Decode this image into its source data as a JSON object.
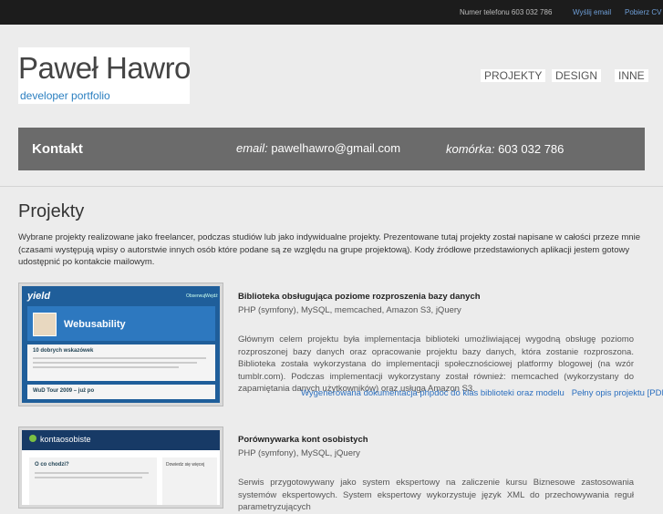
{
  "topbar": {
    "phone_text": "Numer telefonu 603 032 786",
    "send_email": "Wyślij email",
    "download_cv": "Pobierz CV"
  },
  "logo": {
    "name": "Paweł Hawro",
    "subtitle": "developer portfolio"
  },
  "nav": {
    "projekty": "PROJEKTY",
    "design": "DESIGN",
    "inne": "INNE"
  },
  "contact": {
    "title": "Kontakt",
    "email_label": "email:",
    "email_value": "pawelhawro@gmail.com",
    "phone_label": "komórka:",
    "phone_value": "603 032 786"
  },
  "main": {
    "heading": "Projekty",
    "intro": "Wybrane projekty realizowane jako freelancer, podczas studiów lub jako indywidualne projekty. Prezentowane tutaj projekty został napisane w całości przeze mnie (czasami występują wpisy o autorstwie innych osób które podane są ze względu na grupe projektową). Kody źródłowe przedstawionych aplikacji jestem gotowy udostępnić po kontakcie mailowym."
  },
  "projects": [
    {
      "title": "Biblioteka obsługująca poziome rozproszenia bazy danych",
      "tech": "PHP (symfony), MySQL, memcached, Amazon S3, jQuery",
      "description": "Głównym celem projektu była implementacja biblioteki umożliwiającej wygodną obsługę poziomo rozproszonej bazy danych oraz opracowanie projektu bazy danych, która zostanie rozproszona. Biblioteka została wykorzystana do implementacji społecznościowej platformy blogowej (na wzór tumblr.com). Podczas implementacji wykorzystany został również: memcached (wykorzystany do zapamiętania danych użytkowników) oraz usługa Amazon S3.",
      "link_docs": "Wygenerowana dokumentacja phpdoc do klas biblioteki oraz modelu",
      "link_pdf": "Pełny opis projektu [PDF]",
      "thumb": {
        "logo": "yield",
        "tab1": "Obserwuj",
        "tab2": "Wejdź",
        "banner": "Webusability",
        "post_title": "10 dobrych wskazówek",
        "footer": "WuD Tour 2009 – już po"
      }
    },
    {
      "title": "Porównywarka kont osobistych",
      "tech": "PHP (symfony), MySQL, jQuery",
      "description": "Serwis przygotowywany jako system ekspertowy na zaliczenie kursu Biznesowe zastosowania systemów ekspertowych. System ekspertowy wykorzystuje język XML do przechowywania reguł parametryzujących",
      "thumb": {
        "logo": "kontaosobiste",
        "question": "O co chodzi?",
        "side_title": "Dowiedz się więcej"
      }
    }
  ]
}
